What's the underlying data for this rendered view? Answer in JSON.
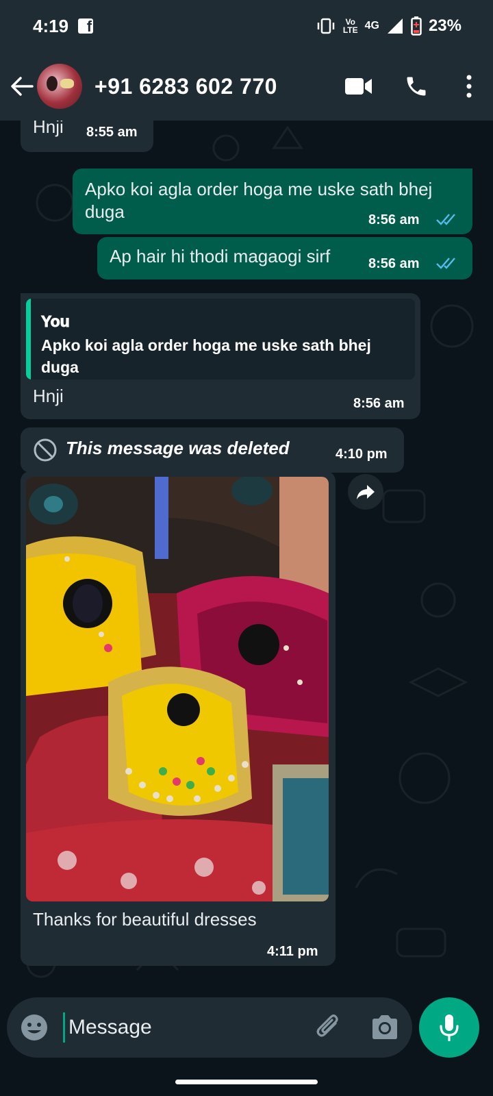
{
  "status_bar": {
    "time": "4:19",
    "network_top": "Vo",
    "network_bottom": "LTE",
    "network_type": "4G",
    "battery": "23%",
    "icons": [
      "facebook-icon",
      "vibrate-icon",
      "signal-icon",
      "battery-low-icon"
    ]
  },
  "header": {
    "contact": "+91 6283 602 770",
    "icons": [
      "back-arrow-icon",
      "video-call-icon",
      "voice-call-icon",
      "more-options-icon"
    ]
  },
  "messages": [
    {
      "direction": "incoming",
      "text": "Hnji",
      "time": "8:55 am"
    },
    {
      "direction": "outgoing",
      "text": "Apko koi agla order hoga me uske sath bhej duga",
      "time": "8:56 am",
      "status": "read"
    },
    {
      "direction": "outgoing",
      "text": "Ap hair hi thodi magaogi sirf",
      "time": "8:56 am",
      "status": "read"
    },
    {
      "direction": "incoming",
      "reply_to": {
        "author": "You",
        "text": "Apko koi agla order hoga me uske sath bhej duga"
      },
      "text": "Hnji",
      "time": "8:56 am"
    },
    {
      "direction": "incoming",
      "deleted": true,
      "text": "This message was deleted",
      "time": "4:10 pm"
    },
    {
      "direction": "incoming",
      "type": "image",
      "caption": "Thanks for beautiful dresses",
      "time": "4:11 pm"
    }
  ],
  "input": {
    "placeholder": "Message",
    "icons": [
      "emoji-icon",
      "attach-icon",
      "camera-icon",
      "mic-icon"
    ]
  },
  "colors": {
    "background": "#0b141a",
    "header": "#1f2c34",
    "incoming_bubble": "#1f2c34",
    "outgoing_bubble": "#005c4b",
    "accent": "#00a884",
    "read_ticks": "#53bdeb"
  }
}
